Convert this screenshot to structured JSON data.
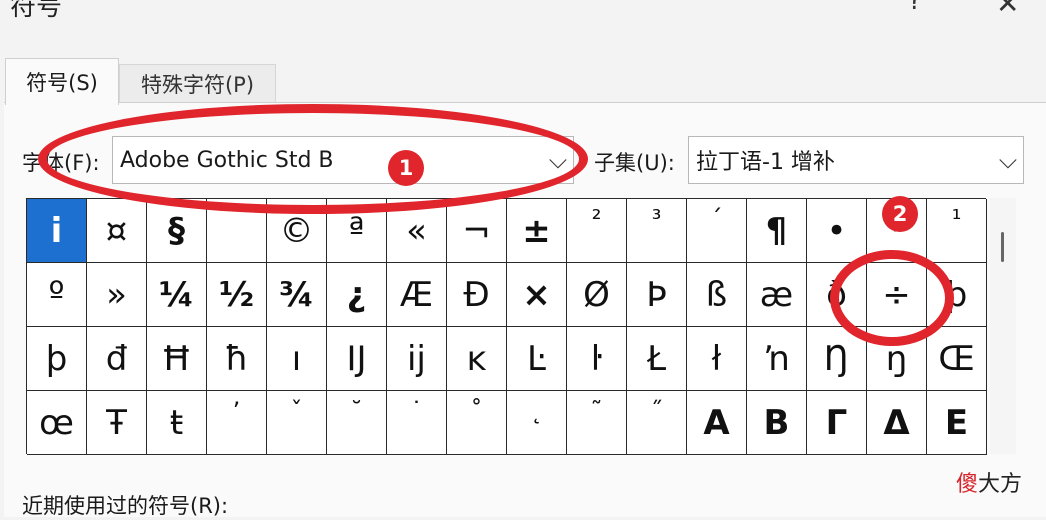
{
  "window": {
    "title": "符号",
    "help_glyph": "?",
    "close_glyph": "✕"
  },
  "tabs": [
    {
      "label": "符号(S)",
      "active": true
    },
    {
      "label": "特殊字符(P)",
      "active": false
    }
  ],
  "font": {
    "label": "字体(F):",
    "value": "Adobe Gothic Std B"
  },
  "subset": {
    "label": "子集(U):",
    "value": "拉丁语-1 增补"
  },
  "chevron_glyph": "⌵",
  "symbols": [
    [
      "i",
      "¤",
      "§",
      "¨",
      "©",
      "ª",
      "«",
      "¬",
      "±",
      "²",
      "³",
      "´",
      "¶",
      "•",
      "¸",
      "¹"
    ],
    [
      "º",
      "»",
      "¼",
      "½",
      "¾",
      "¿",
      "Æ",
      "Ð",
      "×",
      "Ø",
      "Þ",
      "ß",
      "æ",
      "ð",
      "÷",
      "þ"
    ],
    [
      "þ",
      "đ",
      "Ħ",
      "ħ",
      "ı",
      "Ĳ",
      "ĳ",
      "ĸ",
      "Ŀ",
      "ŀ",
      "Ł",
      "ł",
      "ŉ",
      "Ŋ",
      "ŋ",
      "Œ"
    ],
    [
      "œ",
      "Ŧ",
      "ŧ",
      "ʼ",
      "ˇ",
      "˘",
      "˙",
      "˚",
      "˛",
      "˜",
      "˝",
      "Α",
      "Β",
      "Γ",
      "Δ",
      "Ε"
    ]
  ],
  "recent": {
    "label": "近期使用过的符号(R):"
  },
  "annotations": {
    "badge_1": "1",
    "badge_2": "2"
  },
  "watermark": {
    "part1": "傻",
    "part2": "大方"
  }
}
